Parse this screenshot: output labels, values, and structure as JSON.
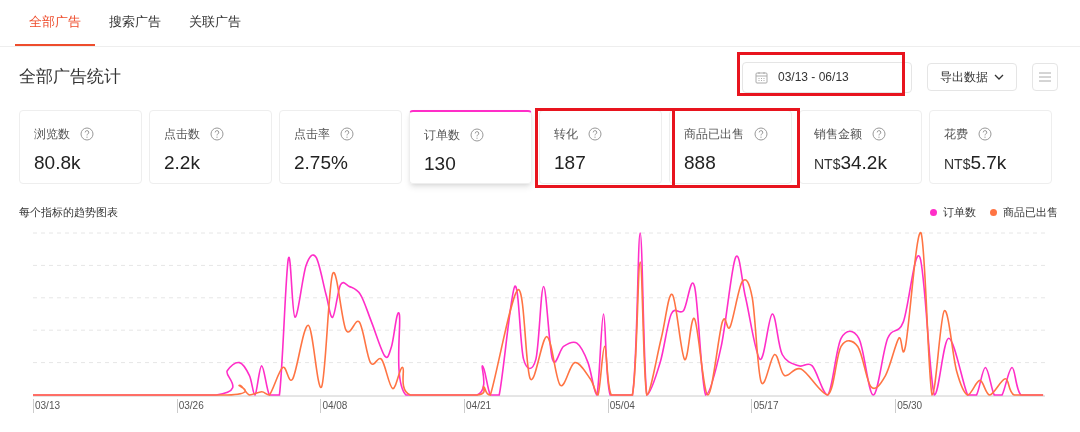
{
  "tabs": [
    {
      "label": "全部广告",
      "selected": true
    },
    {
      "label": "搜索广告",
      "selected": false
    },
    {
      "label": "关联广告",
      "selected": false
    }
  ],
  "section_title": "全部广告统计",
  "date_range": "03/13 - 06/13",
  "export_button": "导出数据",
  "metrics": [
    {
      "label": "浏览数",
      "value": "80.8k",
      "selected": false
    },
    {
      "label": "点击数",
      "value": "2.2k",
      "selected": false
    },
    {
      "label": "点击率",
      "value": "2.75%",
      "selected": false
    },
    {
      "label": "订单数",
      "value": "130",
      "selected": true
    },
    {
      "label": "转化",
      "value": "187",
      "selected": false
    },
    {
      "label": "商品已出售",
      "value": "888",
      "selected": false
    },
    {
      "label": "销售金额",
      "prefix": "NT$",
      "value": "34.2k",
      "selected": false
    },
    {
      "label": "花费",
      "prefix": "NT$",
      "value": "5.7k",
      "selected": false
    }
  ],
  "chart": {
    "title": "每个指标的趋势图表",
    "legend": [
      {
        "label": "订单数",
        "color": "#ff2ec8"
      },
      {
        "label": "商品已出售",
        "color": "#ff7443"
      }
    ],
    "x_labels": [
      "03/13",
      "03/26",
      "04/08",
      "04/21",
      "05/04",
      "05/17",
      "05/30"
    ]
  }
}
